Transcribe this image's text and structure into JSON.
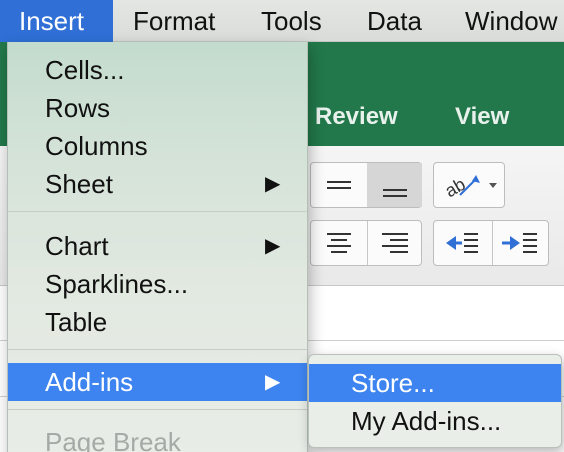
{
  "menubar": {
    "items": [
      "Insert",
      "Format",
      "Tools",
      "Data",
      "Window"
    ],
    "active": "Insert"
  },
  "ribbon": {
    "tabs": [
      "Review",
      "View"
    ]
  },
  "insert_menu": {
    "items": [
      {
        "label": "Cells...",
        "submenu": false,
        "disabled": false
      },
      {
        "label": "Rows",
        "submenu": false,
        "disabled": false
      },
      {
        "label": "Columns",
        "submenu": false,
        "disabled": false
      },
      {
        "label": "Sheet",
        "submenu": true,
        "disabled": false
      },
      {
        "label": "Chart",
        "submenu": true,
        "disabled": false
      },
      {
        "label": "Sparklines...",
        "submenu": false,
        "disabled": false
      },
      {
        "label": "Table",
        "submenu": false,
        "disabled": false
      },
      {
        "label": "Add-ins",
        "submenu": true,
        "disabled": false,
        "highlighted": true
      },
      {
        "label": "Page Break",
        "submenu": false,
        "disabled": true
      }
    ],
    "submenu_arrow": "▶"
  },
  "addins_submenu": {
    "items": [
      {
        "label": "Store...",
        "highlighted": true
      },
      {
        "label": "My Add-ins...",
        "highlighted": false
      }
    ]
  },
  "colors": {
    "menu_highlight": "#3d84f0",
    "ribbon_green": "#22784a",
    "menubar_active": "#2f6fd6"
  }
}
